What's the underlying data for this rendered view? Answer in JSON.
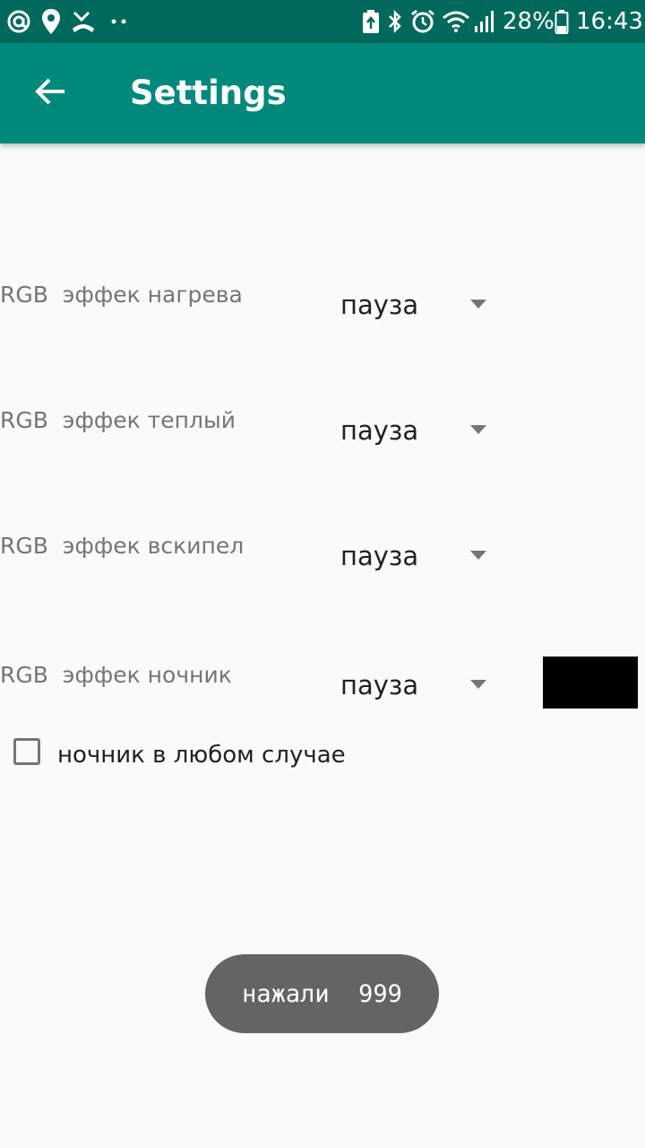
{
  "status_bar": {
    "left_icons": [
      "at-sign-icon",
      "location-pin-icon",
      "missed-call-icon",
      "more-dots-icon"
    ],
    "right_icons": [
      "battery-saver-icon",
      "bluetooth-icon",
      "alarm-icon",
      "wifi-icon",
      "signal-icon",
      "battery-icon"
    ],
    "battery_percent": "28%",
    "time": "16:43"
  },
  "app_bar": {
    "back_icon": "arrow-back-icon",
    "title": "Settings",
    "color": "#00897b",
    "status_color": "#00695c"
  },
  "settings": {
    "rows": [
      {
        "label": "RGB  эффек нагрева",
        "value": "пауза"
      },
      {
        "label": "RGB  эффек теплый",
        "value": "пауза"
      },
      {
        "label": "RGB  эффек вскипел",
        "value": "пауза"
      },
      {
        "label": "RGB  эффек ночник",
        "value": "пауза"
      }
    ],
    "checkbox": {
      "label": "ночник в любом случае",
      "checked": false
    },
    "color_swatch": "#000000"
  },
  "toast": {
    "text": "нажали  999"
  }
}
